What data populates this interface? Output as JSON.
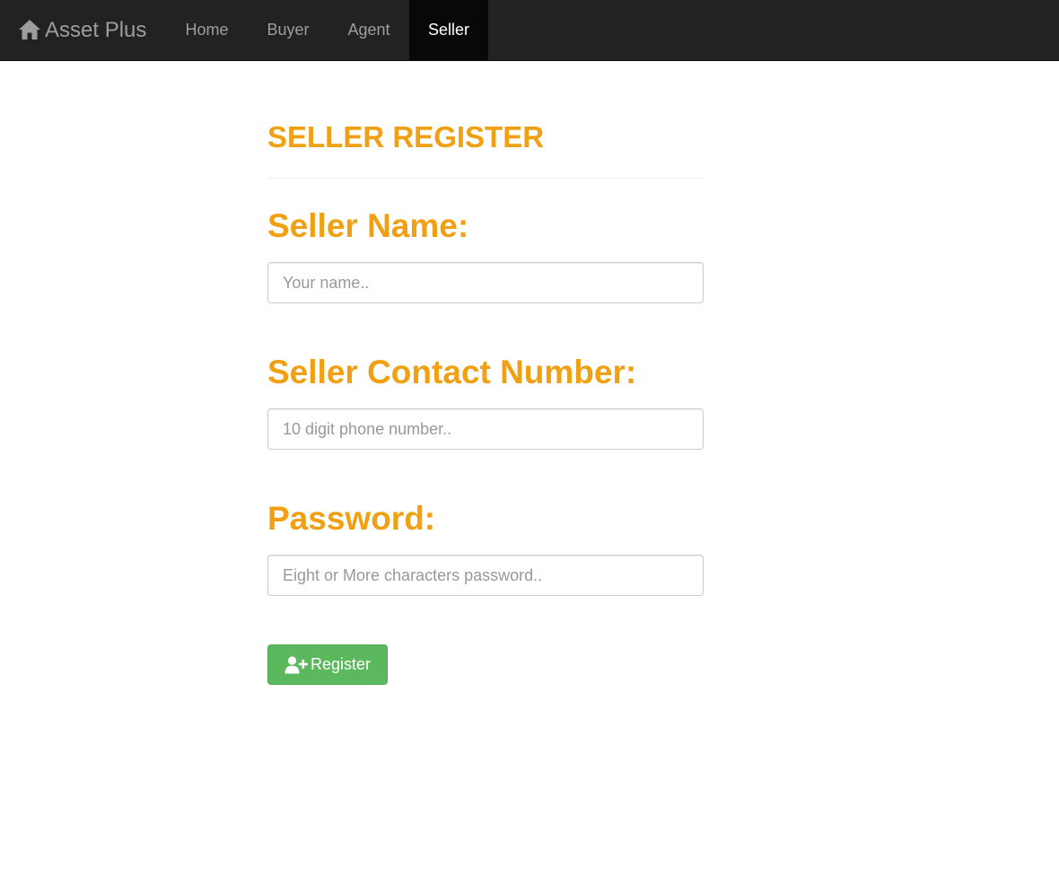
{
  "navbar": {
    "brand": "Asset Plus",
    "brand_icon": "home-icon",
    "items": [
      {
        "label": "Home"
      },
      {
        "label": "Buyer"
      },
      {
        "label": "Agent"
      },
      {
        "label": "Seller"
      }
    ],
    "active": "Seller"
  },
  "form": {
    "title": "SELLER REGISTER",
    "name_label": "Seller Name:",
    "name_placeholder": "Your name..",
    "contact_label": "Seller Contact Number:",
    "contact_placeholder": "10 digit phone number..",
    "password_label": "Password:",
    "password_placeholder": "Eight or More characters password..",
    "register_label": "Register",
    "register_icon": "user-plus-icon"
  },
  "colors": {
    "accent": "#f0a012",
    "navbar_bg": "#222222",
    "button_bg": "#5cb85c"
  }
}
